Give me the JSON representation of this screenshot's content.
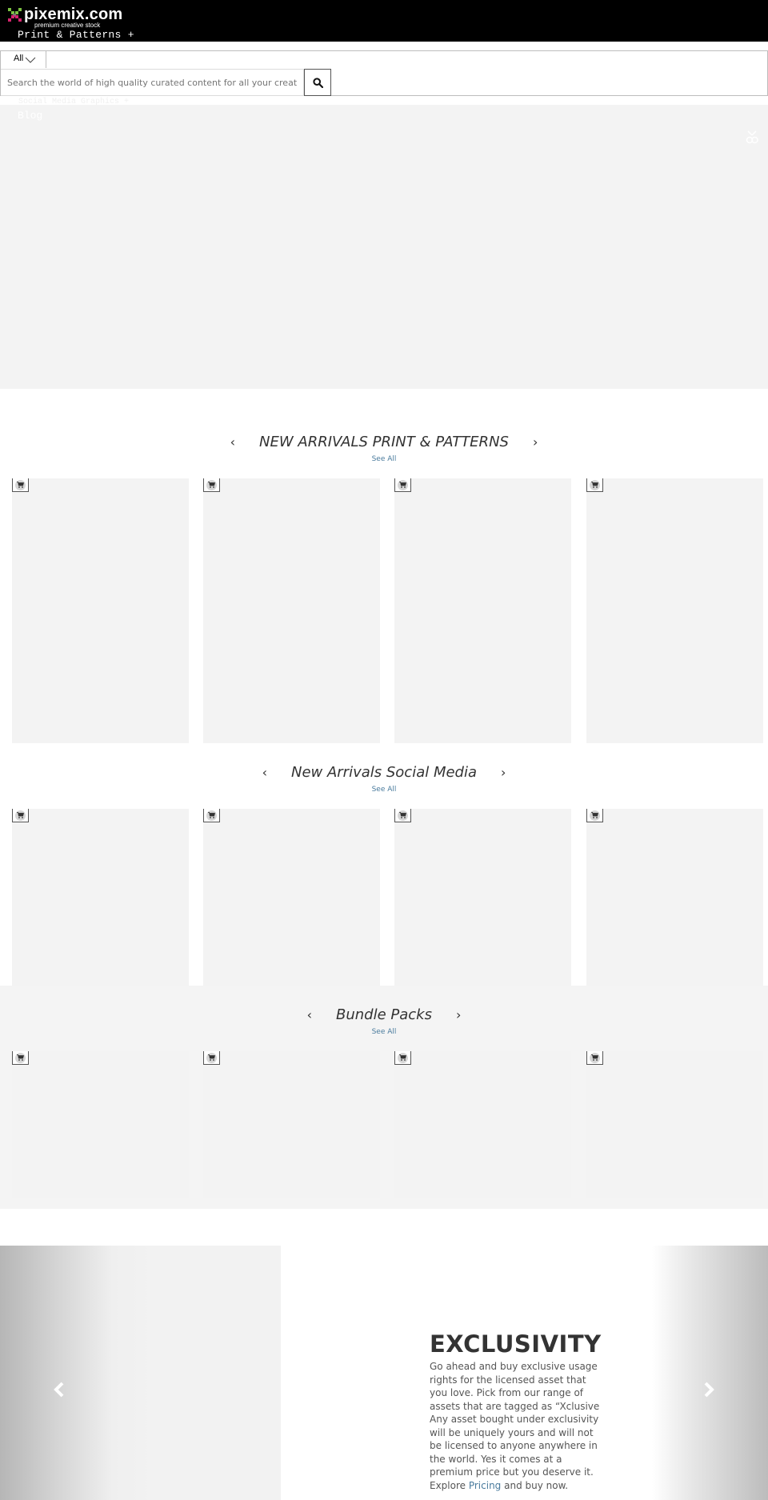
{
  "header": {
    "logo_text": "pixemix.com",
    "logo_tagline": "premium creative stock",
    "nav_item": "Print & Patterns +",
    "hidden_nav": "Social Media Graphics +",
    "logo_colors": {
      "green": "#7cc142",
      "pink": "#d6246e",
      "dark": "#555555"
    }
  },
  "search": {
    "category_selected": "All",
    "placeholder": "Search the world of high quality curated content for all your creative needs",
    "button_icon": "search-icon"
  },
  "hero": {
    "blog_link": "Blog",
    "user_icon": "user-icon"
  },
  "sections": [
    {
      "title": "NEW ARRIVALS PRINT & PATTERNS",
      "see_all": "See All",
      "prev": "‹",
      "next": "›",
      "card_count": 4
    },
    {
      "title": "New Arrivals Social Media",
      "see_all": "See All",
      "prev": "‹",
      "next": "›",
      "card_count": 4
    },
    {
      "title": "Bundle Packs",
      "see_all": "See All",
      "prev": "‹",
      "next": "›",
      "card_count": 4
    }
  ],
  "exclusivity": {
    "title": "EXCLUSIVITY",
    "body_before_link": "Go ahead and buy exclusive usage rights for the licensed asset that you love. Pick from our range of assets that are tagged as “Xclusive Any asset bought under exclusivity will be uniquely yours and will not be licensed to anyone anywhere in the world. Yes it comes at a premium price but you deserve it. Explore ",
    "link_text": "Pricing",
    "body_after_link": " and buy now."
  },
  "colors": {
    "header_bg": "#000000",
    "placeholder_bg": "#f3f3f3",
    "link": "#4a7b9d",
    "text": "#333333"
  }
}
